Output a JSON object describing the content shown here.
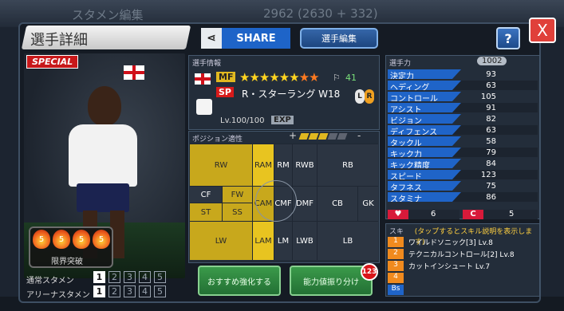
{
  "background": {
    "ghost_title": "スタメン編集",
    "ghost_count": "2962 (2630 + 332)"
  },
  "header": {
    "title": "選手詳細",
    "share_label": "SHARE",
    "edit_label": "選手編集",
    "help_label": "?",
    "close_label": "X"
  },
  "player_card": {
    "special_label": "SPECIAL",
    "limit_break_label": "限界突破",
    "flame_marks": [
      "5",
      "5",
      "5",
      "5"
    ],
    "starter_normal_label": "通常スタメン",
    "starter_arena_label": "アリーナスタメン",
    "slots": [
      "1",
      "2",
      "3",
      "4",
      "5"
    ]
  },
  "info": {
    "section_label": "選手情報",
    "position": "MF",
    "rarity_tag": "SP",
    "stars": "★★★★★★",
    "half_stars": "★★",
    "boot_value": "41",
    "name": "R・スターラング W18",
    "foot_left": "L",
    "foot_right": "R",
    "level": "Lv.100/100",
    "exp_label": "EXP"
  },
  "positions": {
    "section_label": "ポジション適性",
    "gauge_plus": "+",
    "gauge_minus": "-",
    "gauge_level": 3,
    "cells": {
      "rw": "RW",
      "ram": "RAM",
      "rm": "RM",
      "rwb": "RWB",
      "rb": "RB",
      "cf": "CF",
      "fw": "FW",
      "st": "ST",
      "ss": "SS",
      "cam": "CAM",
      "cmf": "CMF",
      "dmf": "DMF",
      "cb": "CB",
      "gk": "GK",
      "lw": "LW",
      "lam": "LAM",
      "lm": "LM",
      "lwb": "LWB",
      "lb": "LB"
    },
    "recommend_training": "おすすめ強化する",
    "bulk_training": "能力値振り分け",
    "badge_count": "123"
  },
  "stats": {
    "section_label": "選手力",
    "total": "1002",
    "rows": [
      {
        "label": "決定力",
        "value": "93"
      },
      {
        "label": "ヘディング",
        "value": "63"
      },
      {
        "label": "コントロール",
        "value": "105"
      },
      {
        "label": "アシスト",
        "value": "91"
      },
      {
        "label": "ビジョン",
        "value": "82"
      },
      {
        "label": "ディフェンス",
        "value": "63"
      },
      {
        "label": "タックル",
        "value": "58"
      },
      {
        "label": "キック力",
        "value": "79"
      },
      {
        "label": "キック精度",
        "value": "84"
      },
      {
        "label": "スピード",
        "value": "123"
      },
      {
        "label": "タフネス",
        "value": "75"
      },
      {
        "label": "スタミナ",
        "value": "86"
      }
    ],
    "heart_value": "6",
    "c_label": "C",
    "c_value": "5"
  },
  "skills": {
    "section_label": "スキル",
    "hint": "(タップするとスキル説明を表示します)",
    "rows": [
      {
        "num": "1",
        "text": "ワイルドソニック[3] Lv.8"
      },
      {
        "num": "2",
        "text": "テクニカルコントロール[2] Lv.8"
      },
      {
        "num": "3",
        "text": "カットインシュート Lv.7"
      },
      {
        "num": "4",
        "text": ""
      },
      {
        "num": "Bs",
        "text": ""
      }
    ]
  }
}
